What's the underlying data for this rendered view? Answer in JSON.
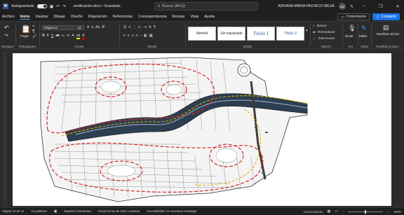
{
  "titlebar": {
    "autosave_label": "Autoguardado",
    "doc_title": "zonificación.docx • Guardado",
    "search_placeholder": "Buscar (Alt+Q)",
    "user_name": "ADRIANA MARIA PACHECO MEJIA",
    "user_initials": "AM"
  },
  "menu": {
    "items": [
      "Archivo",
      "Inicio",
      "Insertar",
      "Dibujar",
      "Diseño",
      "Disposición",
      "Referencias",
      "Correspondencia",
      "Revisar",
      "Vista",
      "Ayuda"
    ],
    "active": "Inicio",
    "comments_label": "Comentarios",
    "share_label": "Compartir"
  },
  "ribbon": {
    "groups": {
      "undo": "Deshacer",
      "clipboard": "Portapapeles",
      "font": "Fuente",
      "paragraph": "Párrafo",
      "styles": "Estilos",
      "editing": "Edición",
      "voice": "Voz",
      "editor": "Editor",
      "reuse": "Reutilizar archivo"
    },
    "paste_label": "Pegar",
    "font_name": "Segoe UI",
    "font_size": "11",
    "styles": [
      "Normal",
      "Sin espaciado",
      "Título 1",
      "Título 2"
    ],
    "editing": [
      "Buscar",
      "Reemplazar",
      "Seleccionar"
    ],
    "dictate_label": "Dictar",
    "editor_label": "Editor",
    "reuse_label": "Reutilizar archivo"
  },
  "status": {
    "page": "Página 12 de 12",
    "words": "10 palabras",
    "language": "Español (Honduras)",
    "predictions": "Predicciones de texto: activado",
    "accessibility": "Accesibilidad: es necesario investigar",
    "focus": "Concentración",
    "zoom": "100%"
  }
}
